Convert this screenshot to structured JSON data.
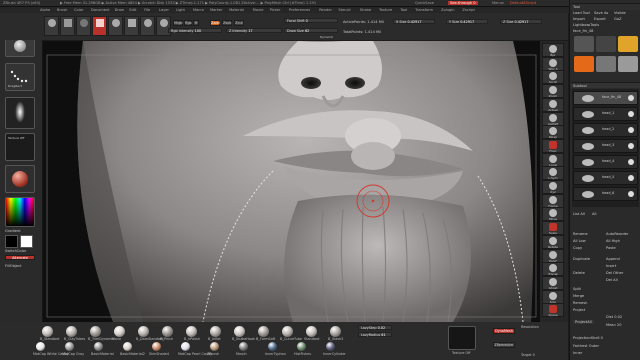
{
  "titlebar": {
    "app": "ZBrush 4R7 P3 (x64)",
    "info": "▶ Free Mem 31.298GB ▶ Active Mem 4854 ▶ Scratch Disk 1533 ▶ ZTime▷1.171 ▶ PolyCount▷1.081 ZActive:... ▶ PolyMesh Ctrl (#Time) 1.191",
    "quicksave": "QuickSave",
    "seethrough": "See-through 0",
    "menus_btn": "Menus",
    "default_script": "DefaultZScript"
  },
  "menus": [
    "Alpha",
    "Brush",
    "Color",
    "Document",
    "Draw",
    "Edit",
    "File",
    "Layer",
    "Light",
    "Macro",
    "Marker",
    "Material",
    "Movie",
    "Picker",
    "Preferences",
    "Render",
    "Stencil",
    "Stroke",
    "Texture",
    "Tool",
    "Transform",
    "Zplugin",
    "Zscript"
  ],
  "shelf": {
    "buttons": [
      "Projection Master",
      "LightBox",
      "Quick Sketch",
      "Edit",
      "Draw",
      "Move",
      "Scale",
      "Rotate"
    ],
    "mrgb": "Mrgb",
    "rgb": "Rgb",
    "m": "M",
    "zadd": "Zadd",
    "zsub": "Zsub",
    "zcut": "Zcut",
    "rgb_intensity": {
      "label": "Rgb Intensity",
      "value": "100"
    },
    "z_intensity": {
      "label": "Z Intensity",
      "value": "17"
    },
    "focal_shift": {
      "label": "Focal Shift",
      "value": "0"
    },
    "draw_size": {
      "label": "Draw Size",
      "value": "62"
    },
    "dynamic": "Dynamic",
    "active_points": {
      "label": "ActivePoints:",
      "value": "1.414 Mil"
    },
    "total_points": {
      "label": "TotalPoints:",
      "value": "1.414 Mil"
    },
    "x_size": {
      "label": "X Size",
      "value": "0.42917"
    },
    "y_size": {
      "label": "Y Size",
      "value": "0.42917"
    },
    "z_size": {
      "label": "Z Size",
      "value": "0.42917"
    }
  },
  "lefttray": {
    "lightbox": "LightBox",
    "stroke": "DragRect",
    "alpha": "Texture Off",
    "material": "MatCap Red Wax",
    "gradient": "Gradient",
    "switchcolor": "SwitchColor",
    "alternate": "Alternate",
    "fill_object": "FillObject"
  },
  "rightshelf": [
    "Bpr",
    "SPix 3",
    "Scroll",
    "Zoom",
    "Actual",
    "AAHalf",
    "Persp",
    "Floor",
    "Local",
    "L.Sym",
    "Xyz",
    "Frame",
    "Move",
    "Scale",
    "Rotate",
    "PolyF",
    "Transp",
    "Ghost",
    "Solo",
    "Xpose"
  ],
  "rightpanel": {
    "menus": [
      "Close",
      "Save",
      "Visible",
      "Sub",
      "Tool",
      "Import",
      "Export",
      "Load Tool",
      "Save As",
      "Copy Tool",
      "Paste Tool",
      "Make PolyMesh3D",
      "GoZ",
      "All",
      "R"
    ],
    "lightbox_tools": "Lightbox▸Tools",
    "tool_name": "face_fin_48",
    "subtools": [
      "Subtool",
      "face_fin_48",
      "head_1",
      "head_2",
      "head_3",
      "head_4",
      "head_5",
      "head_6"
    ],
    "list_all": "List All",
    "list_all_btn": "All",
    "rename": "Rename",
    "autoreorder": "AutoReorder",
    "all_low": "All Low",
    "all_high": "All High",
    "copy": "Copy",
    "paste": "Paste",
    "duplicate": "Duplicate",
    "append": "Append",
    "insert": "Insert",
    "delete": "Delete",
    "del_other": "Del Other",
    "del_all": "Del All",
    "split": "Split",
    "merge": "Merge",
    "remesh": "Remesh",
    "project": "Project",
    "dist": "Dist 0.02",
    "projectall": "ProjectAll",
    "mean": "Mean 20",
    "projectionshell": "ProjectionShell 0",
    "farthest_outer": "Farthest Outer",
    "inner": "Inner"
  },
  "bottom": {
    "brushes": [
      "B_Standard",
      "B_ClayTubes",
      "B_TrimDynamic",
      "Move",
      "B_DamStandard",
      "B_Pinch",
      "B_hPolish",
      "B_Inflat",
      "B_SnakeHook",
      "B_FormSoft",
      "B_CurveTube",
      "Standard",
      "B_Slash3"
    ],
    "materials": [
      "MatCap White Cavity",
      "MatCap Gray",
      "BasicMaterial",
      "BasicMaterial2",
      "SkinShade4",
      "MatCap Pearl Cavity",
      "ZBrush",
      "Morph",
      "InnerTyphon",
      "HistFishes",
      "InnerCylinder"
    ],
    "lazystep": {
      "label": "LazyStep",
      "value": "0.02"
    },
    "lazyradius": {
      "label": "LazyRadius",
      "value": "61"
    },
    "texture_off": "Texture Off",
    "dynamesh": "DynaMesh",
    "zremesher": "ZRemesher",
    "resolution": "Resolution",
    "target": "Target 0"
  },
  "colors": {
    "accent_red": "#b8322b",
    "accent_orange": "#c9621e",
    "clay": "#a6a2a1"
  }
}
